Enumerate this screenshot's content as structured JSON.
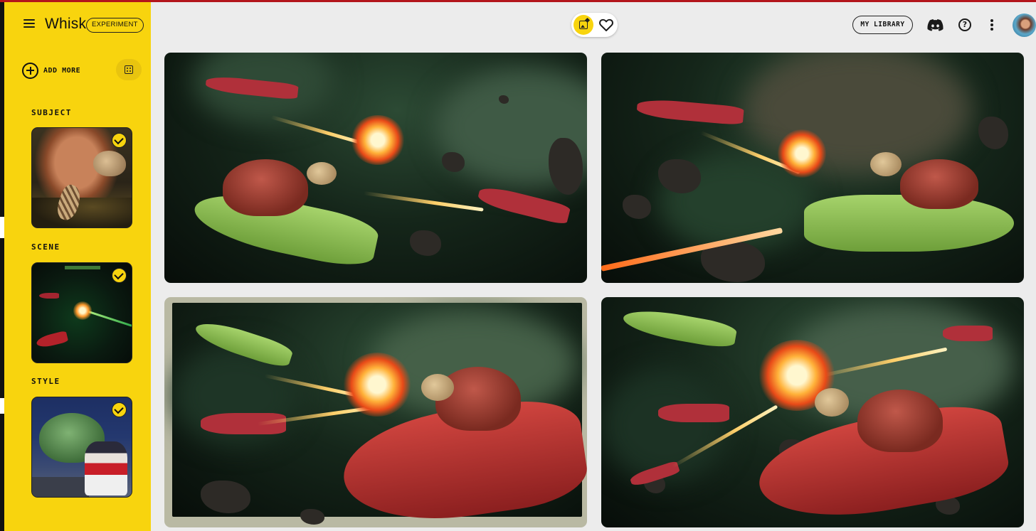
{
  "app": {
    "title": "Whisk",
    "badge": "EXPERIMENT"
  },
  "sidebar": {
    "add_more_label": "ADD MORE",
    "sections": [
      {
        "label": "SUBJECT",
        "selected": true
      },
      {
        "label": "SCENE",
        "selected": true
      },
      {
        "label": "STYLE",
        "selected": true
      }
    ]
  },
  "header": {
    "library_label": "MY LIBRARY",
    "active_mode": "image"
  },
  "icons": {
    "menu": "hamburger-menu-icon",
    "add": "plus-circle-icon",
    "random": "dice-icon",
    "check": "checkmark-icon",
    "image_mode": "image-sparkle-icon",
    "favorites": "heart-icon",
    "discord": "discord-icon",
    "help": "help-circle-icon",
    "more": "kebab-menu-icon",
    "avatar": "user-avatar"
  },
  "results": {
    "count": 4,
    "selected_index": 2
  },
  "colors": {
    "sidebar_bg": "#f8d40e",
    "page_bg": "#ececec",
    "top_accent": "#b3151b",
    "selected_card_frame": "#b9b9a3"
  }
}
